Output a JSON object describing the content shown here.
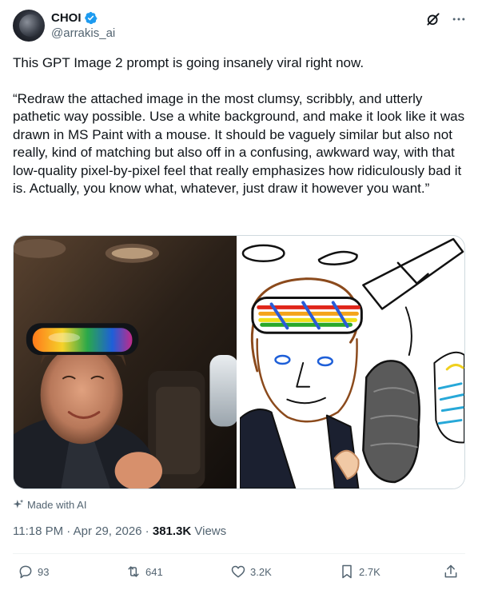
{
  "author": {
    "name": "CHOI",
    "handle": "@arrakis_ai"
  },
  "tweet": {
    "paragraph_1": "This GPT Image 2 prompt is going insanely viral right now.",
    "paragraph_2": "“Redraw the attached image in the most clumsy, scribbly, and utterly pathetic way possible. Use a white background, and make it look like it was drawn in MS Paint with a mouse. It should be vaguely similar but also not really, kind of matching but also off in a confusing, awkward way, with that low-quality pixel-by-pixel feel that really emphasizes how ridiculously bad it is. Actually, you know what, whatever, just draw it however you want.”"
  },
  "media_label": "Made with AI",
  "meta": {
    "time": "11:18 PM",
    "separator": " · ",
    "date": "Apr 29, 2026",
    "views_count": "381.3K",
    "views_label": " Views"
  },
  "actions": {
    "replies": "93",
    "reposts": "641",
    "likes": "3.2K",
    "bookmarks": "2.7K"
  },
  "colors": {
    "text_primary": "#0f1419",
    "text_secondary": "#536471",
    "verified_blue": "#1d9bf0",
    "border": "#cfd9de"
  },
  "icons": [
    "verified-badge-icon",
    "grok-icon",
    "more-icon",
    "sparkle-icon",
    "reply-icon",
    "repost-icon",
    "like-icon",
    "bookmark-icon",
    "share-icon"
  ]
}
